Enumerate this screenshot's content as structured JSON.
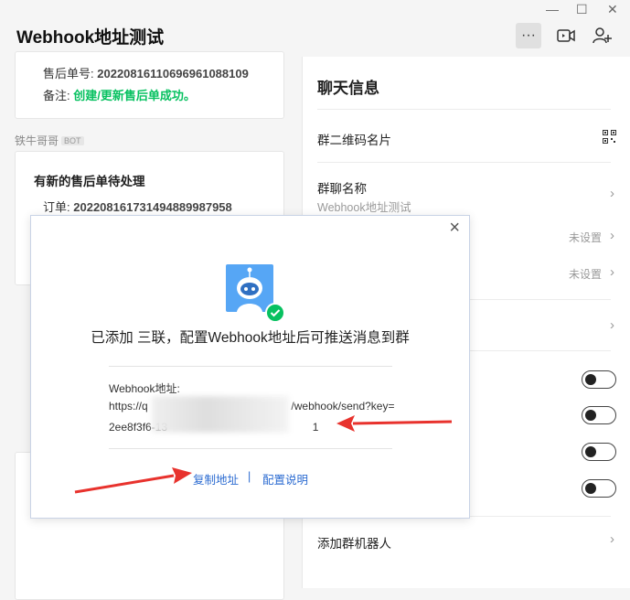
{
  "window": {
    "title": "Webhook地址测试"
  },
  "chat": {
    "card1": {
      "order_label": "售后单号:",
      "order_value": "20220816110696961088109",
      "note_label": "备注:",
      "note_value": "创建/更新售后单成功。"
    },
    "sender": {
      "name": "铁牛哥哥",
      "tag": "BOT"
    },
    "card2": {
      "title": "有新的售后单待处理",
      "order_label": "订单:",
      "order_value": "202208161731494889987958"
    }
  },
  "panel": {
    "title": "聊天信息",
    "qr_label": "群二维码名片",
    "group_name_label": "群聊名称",
    "group_name_value": "Webhook地址测试",
    "unset_1": "未设置",
    "unset_2": "未设置",
    "add_bot_label": "添加群机器人",
    "toggles": [
      false,
      false,
      false,
      false
    ]
  },
  "dialog": {
    "message": "已添加 三联，配置Webhook地址后可推送消息到群",
    "address_label": "Webhook地址:",
    "url_line1_start": "https://q",
    "url_line1_end": "/webhook/send?key=",
    "url_line2_start": "2ee8f3f6-13",
    "url_line2_end": "1",
    "copy_link": "复制地址",
    "divider": "|",
    "config_link": "配置说明"
  },
  "colors": {
    "accent_blue": "#2b6bd1",
    "success_green": "#07c160",
    "arrow_red": "#e8322d",
    "bot_blue": "#56a6f5"
  }
}
